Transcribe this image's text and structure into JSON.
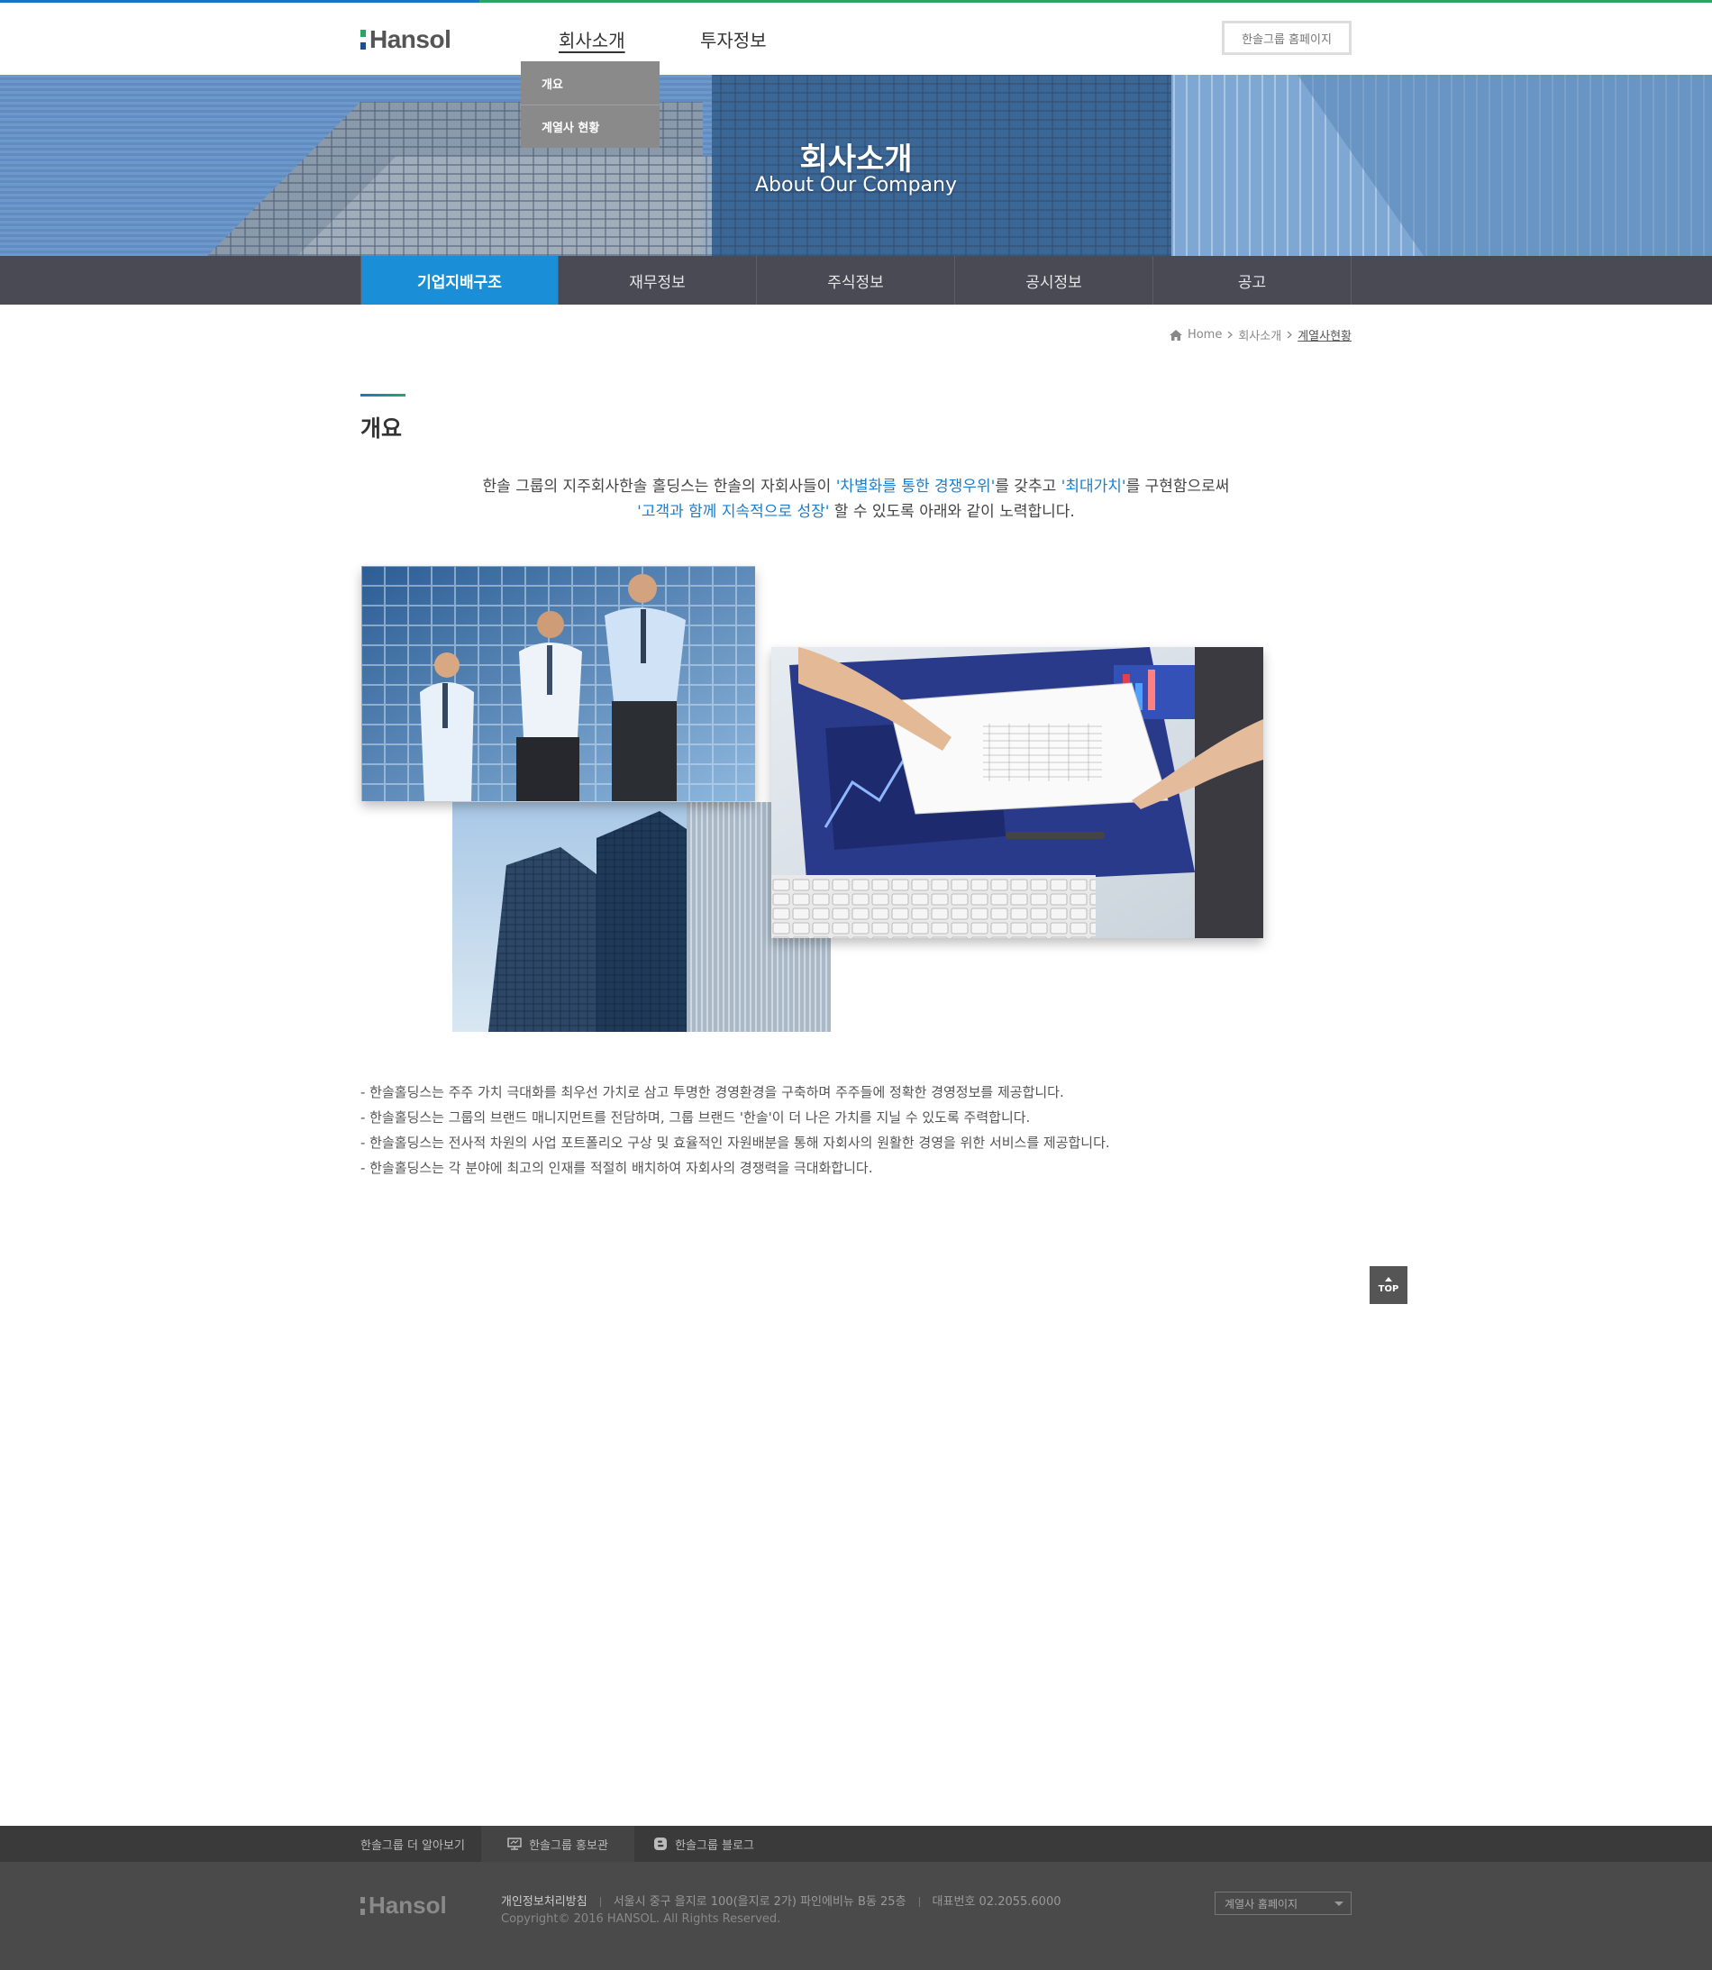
{
  "header": {
    "logo_text": "Hansol",
    "gnb": [
      "회사소개",
      "투자정보"
    ],
    "home_button": "한솔그룹 홈페이지"
  },
  "dropdown": [
    "개요",
    "계열사 현황"
  ],
  "hero": {
    "title": "회사소개",
    "subtitle": "About Our Company"
  },
  "lnb": [
    "기업지배구조",
    "재무정보",
    "주식정보",
    "공시정보",
    "공고"
  ],
  "breadcrumb": {
    "home": "Home",
    "level1": "회사소개",
    "current": "계열사현황"
  },
  "section": {
    "title": "개요"
  },
  "intro": {
    "line1_a": "한솔 그룹의 지주회사한솔 홀딩스는 한솔의 자회사들이 ",
    "line1_hl1": "'차별화를 통한 경쟁우위'",
    "line1_b": "를 갖추고 ",
    "line1_hl2": "'최대가치'",
    "line1_c": "를 구현함으로써",
    "line2_hl": "'고객과 함께 지속적으로 성장'",
    "line2_b": " 할 수 있도록 아래와 같이 노력합니다."
  },
  "bullets": [
    "- 한솔홀딩스는 주주 가치 극대화를 최우선 가치로 삼고 투명한 경영환경을 구축하며 주주들에 정확한  경영정보를 제공합니다.",
    "- 한솔홀딩스는 그룹의 브랜드 매니지먼트를 전담하며, 그룹 브랜드 '한솔'이 더 나은 가치를 지닐 수 있도록 주력합니다.",
    "- 한솔홀딩스는 전사적 차원의 사업 포트폴리오 구상 및 효율적인 자원배분을 통해 자회사의 원활한 경영을 위한 서비스를 제공합니다.",
    "- 한솔홀딩스는 각 분야에 최고의 인재를 적절히 배치하여 자회사의 경쟁력을 극대화합니다."
  ],
  "top_button": "TOP",
  "footer": {
    "more": "한솔그룹 더 알아보기",
    "tab1": "한솔그룹 홍보관",
    "tab2": "한솔그룹 블로그",
    "logo_text": "Hansol",
    "privacy": "개인정보처리방침",
    "address": "서울시 중구 을지로 100(을지로 2가) 파인에비뉴 B동 25층",
    "phone": "대표번호  02.2055.6000",
    "copyright": "Copyright© 2016 HANSOL. All Rights Reserved.",
    "family_select": "계열사 홈페이지"
  },
  "colors": {
    "accent_blue": "#1a8fd8",
    "brand_green": "#2aa564",
    "lnb_bg": "#4a4a55"
  }
}
